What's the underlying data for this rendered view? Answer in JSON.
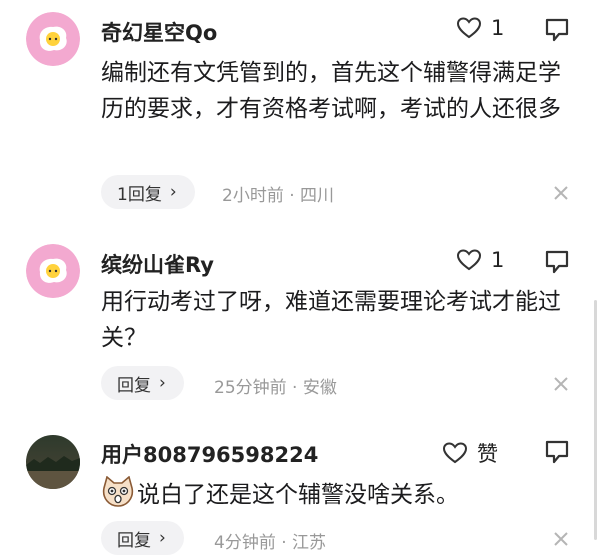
{
  "comments": [
    {
      "username": "奇幻星空Qo",
      "likes": "1",
      "text": "编制还有文凭管到的，首先这个辅警得满足学历的要求，才有资格考试啊，考试的人还很多",
      "reply_label": "1回复",
      "time": "2小时前",
      "location": "四川",
      "avatar_icon": "fried-egg-avatar",
      "avatar_color": "#f3a9d0"
    },
    {
      "username": "缤纷山雀Ry",
      "likes": "1",
      "text": "用行动考过了呀，难道还需要理论考试才能过关？",
      "reply_label": "回复",
      "time": "25分钟前",
      "location": "安徽",
      "avatar_icon": "fried-egg-avatar",
      "avatar_color": "#f3a9d0"
    },
    {
      "username": "用户808796598224",
      "like_label": "赞",
      "text": "说白了还是这个辅警没啥关系。",
      "inline_emoji": "surprised-cat-emoji",
      "reply_label": "回复",
      "time": "4分钟前",
      "location": "江苏",
      "avatar_icon": "photo-avatar"
    }
  ],
  "separator": "·"
}
